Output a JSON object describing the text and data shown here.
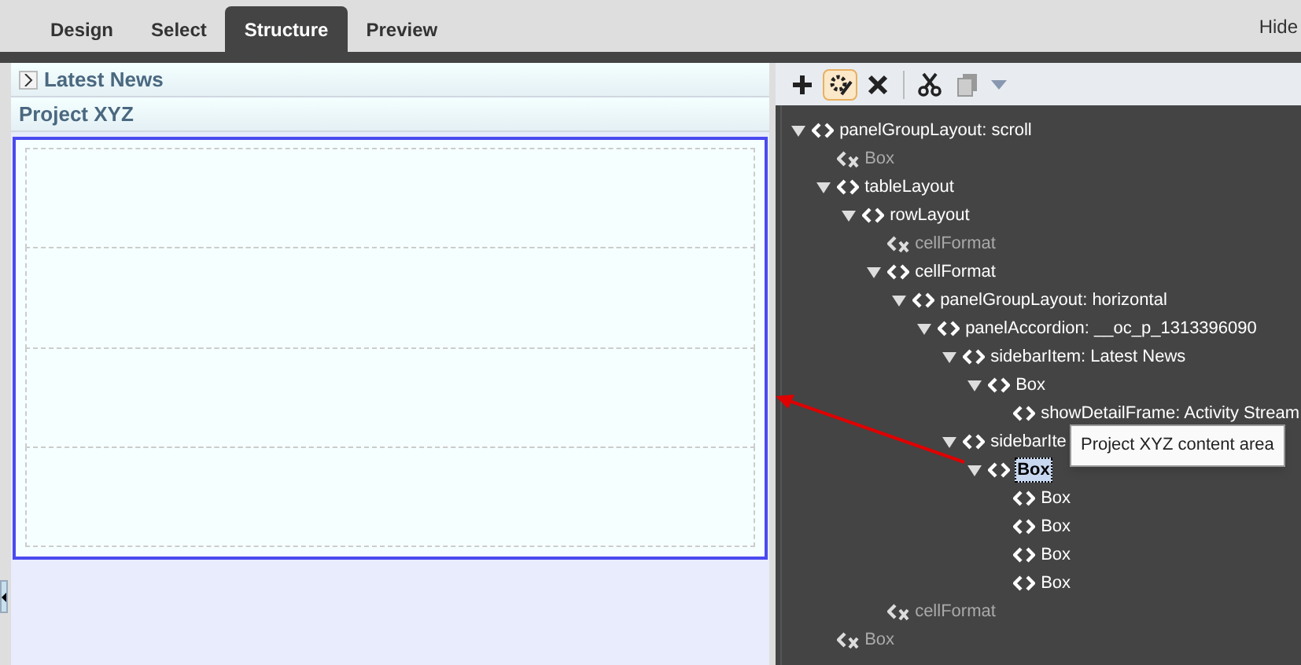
{
  "tabs": [
    {
      "label": "Design",
      "selected": false
    },
    {
      "label": "Select",
      "selected": false
    },
    {
      "label": "Structure",
      "selected": true
    },
    {
      "label": "Preview",
      "selected": false
    }
  ],
  "hide_link": "Hide",
  "canvas": {
    "accordion": [
      {
        "label": "Latest News",
        "expanded": false
      },
      {
        "label": "Project XYZ",
        "expanded": true
      }
    ],
    "content_selected": true
  },
  "toolbar": [
    {
      "kind": "add",
      "active": false,
      "disabled": false
    },
    {
      "kind": "edit",
      "active": true,
      "disabled": false
    },
    {
      "kind": "delete",
      "active": false,
      "disabled": false
    },
    {
      "kind": "cut",
      "active": false,
      "disabled": false
    },
    {
      "kind": "copy",
      "active": false,
      "disabled": true
    }
  ],
  "tree": [
    {
      "label": "panelGroupLayout: scroll",
      "kind": "element",
      "expanded": true,
      "selected": false,
      "children": [
        {
          "label": "Box",
          "kind": "hidden",
          "selected": false
        },
        {
          "label": "tableLayout",
          "kind": "element",
          "expanded": true,
          "selected": false,
          "children": [
            {
              "label": "rowLayout",
              "kind": "element",
              "expanded": true,
              "selected": false,
              "children": [
                {
                  "label": "cellFormat",
                  "kind": "hidden",
                  "selected": false
                },
                {
                  "label": "cellFormat",
                  "kind": "element",
                  "expanded": true,
                  "selected": false,
                  "children": [
                    {
                      "label": "panelGroupLayout: horizontal",
                      "kind": "element",
                      "expanded": true,
                      "selected": false,
                      "children": [
                        {
                          "label": "panelAccordion: __oc_p_1313396090",
                          "kind": "element",
                          "expanded": true,
                          "selected": false,
                          "children": [
                            {
                              "label": "sidebarItem: Latest News",
                              "kind": "element",
                              "expanded": true,
                              "selected": false,
                              "children": [
                                {
                                  "label": "Box",
                                  "kind": "element",
                                  "expanded": true,
                                  "selected": false,
                                  "children": [
                                    {
                                      "label": "showDetailFrame: Activity Stream",
                                      "kind": "element",
                                      "selected": false
                                    }
                                  ]
                                }
                              ]
                            },
                            {
                              "label": "sidebarIte",
                              "kind": "element",
                              "expanded": true,
                              "selected": false,
                              "children": [
                                {
                                  "label": "Box",
                                  "kind": "element",
                                  "expanded": true,
                                  "selected": true,
                                  "children": [
                                    {
                                      "label": "Box",
                                      "kind": "element",
                                      "selected": false
                                    },
                                    {
                                      "label": "Box",
                                      "kind": "element",
                                      "selected": false
                                    },
                                    {
                                      "label": "Box",
                                      "kind": "element",
                                      "selected": false
                                    },
                                    {
                                      "label": "Box",
                                      "kind": "element",
                                      "selected": false
                                    }
                                  ]
                                }
                              ]
                            }
                          ]
                        }
                      ]
                    }
                  ]
                },
                {
                  "label": "cellFormat",
                  "kind": "hidden",
                  "selected": false
                }
              ]
            }
          ]
        },
        {
          "label": "Box",
          "kind": "hidden",
          "selected": false
        }
      ]
    }
  ],
  "tooltip": "Project XYZ content area"
}
